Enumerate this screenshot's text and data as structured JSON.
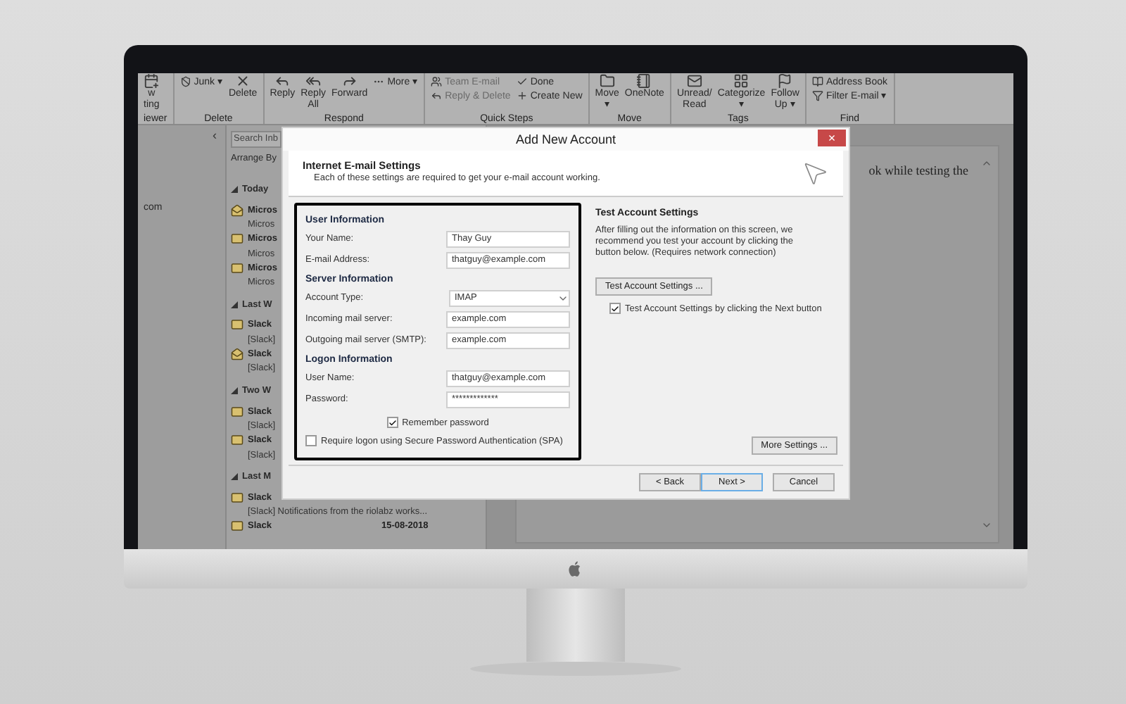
{
  "ribbon": {
    "groups": [
      {
        "label": "iewer",
        "items": [
          {
            "kind": "large",
            "lines": [
              "w",
              "ting"
            ]
          }
        ]
      },
      {
        "label": "Delete",
        "items": [
          {
            "kind": "stack",
            "buttons": [
              {
                "label": "Junk ▾",
                "disabled": false
              }
            ]
          },
          {
            "kind": "large",
            "lines": [
              "Delete"
            ]
          }
        ]
      },
      {
        "label": "Respond",
        "items": [
          {
            "kind": "large",
            "lines": [
              "Reply"
            ]
          },
          {
            "kind": "large",
            "lines": [
              "Reply",
              "All"
            ]
          },
          {
            "kind": "large",
            "lines": [
              "Forward"
            ]
          },
          {
            "kind": "stack",
            "buttons": [
              {
                "label": "More ▾",
                "disabled": false
              }
            ]
          }
        ]
      },
      {
        "label": "Quick Steps",
        "items": [
          {
            "kind": "stack",
            "buttons": [
              {
                "label": "Team E-mail",
                "disabled": true
              },
              {
                "label": "Reply & Delete",
                "disabled": true
              }
            ]
          },
          {
            "kind": "stack",
            "buttons": [
              {
                "label": "Done",
                "disabled": false
              },
              {
                "label": "Create New",
                "disabled": false
              }
            ]
          }
        ]
      },
      {
        "label": "Move",
        "items": [
          {
            "kind": "large",
            "lines": [
              "Move",
              "▾"
            ]
          },
          {
            "kind": "large",
            "lines": [
              "OneNote"
            ]
          }
        ]
      },
      {
        "label": "Tags",
        "items": [
          {
            "kind": "large",
            "lines": [
              "Unread/",
              "Read"
            ]
          },
          {
            "kind": "large",
            "lines": [
              "Categorize",
              "▾"
            ]
          },
          {
            "kind": "large",
            "lines": [
              "Follow",
              "Up ▾"
            ]
          }
        ]
      },
      {
        "label": "Find",
        "items": [
          {
            "kind": "stack",
            "buttons": [
              {
                "label": "Address Book",
                "disabled": false
              },
              {
                "label": "Filter E-mail ▾",
                "disabled": false
              }
            ]
          }
        ]
      }
    ]
  },
  "folders": {
    "collapse": "‹",
    "items": [
      {
        "label": "com",
        "selected": false
      }
    ]
  },
  "list": {
    "search": {
      "placeholder": "Search Inb"
    },
    "arrange": "Arrange By",
    "groups": [
      {
        "header": "Today",
        "messages": [
          {
            "sender": "Micros",
            "preview": "Micros",
            "read": true
          },
          {
            "sender": "Micros",
            "preview": "Micros",
            "read": false
          },
          {
            "sender": "Micros",
            "preview": "Micros",
            "read": false
          }
        ]
      },
      {
        "header": "Last W",
        "messages": [
          {
            "sender": "Slack",
            "preview": "[Slack]",
            "read": false
          },
          {
            "sender": "Slack",
            "preview": "[Slack]",
            "read": true
          }
        ]
      },
      {
        "header": "Two W",
        "messages": [
          {
            "sender": "Slack",
            "preview": "[Slack]",
            "read": false
          },
          {
            "sender": "Slack",
            "preview": "[Slack]",
            "read": false
          }
        ]
      },
      {
        "header": "Last M",
        "messages": [
          {
            "sender": "Slack",
            "preview": "[Slack] Notifications from the riolabz works...",
            "read": false
          },
          {
            "sender": "Slack",
            "date": "15-08-2018",
            "read": false
          }
        ]
      }
    ]
  },
  "reading": {
    "text": "ok while testing the"
  },
  "dialog": {
    "title": "Add New Account",
    "close": "×",
    "header": {
      "title": "Internet E-mail Settings",
      "subtitle": "Each of these settings are required to get your e-mail account working."
    },
    "sections": [
      {
        "title": "User Information",
        "fields": [
          {
            "label": "Your Name:",
            "value": "Thay Guy",
            "kind": "text"
          },
          {
            "label": "E-mail Address:",
            "value": "thatguy@example.com",
            "kind": "text"
          }
        ]
      },
      {
        "title": "Server Information",
        "fields": [
          {
            "label": "Account Type:",
            "value": "IMAP",
            "kind": "select"
          },
          {
            "label": "Incoming mail server:",
            "value": "example.com",
            "kind": "text"
          },
          {
            "label": "Outgoing mail server (SMTP):",
            "value": "example.com",
            "kind": "text"
          }
        ]
      },
      {
        "title": "Logon Information",
        "fields": [
          {
            "label": "User Name:",
            "value": "thatguy@example.com",
            "kind": "text"
          },
          {
            "label": "Password:",
            "value": "*************",
            "kind": "text"
          }
        ]
      }
    ],
    "remember_password": {
      "label": "Remember password",
      "checked": true
    },
    "spa": {
      "label": "Require logon using Secure Password Authentication (SPA)",
      "checked": false
    },
    "test": {
      "title": "Test Account Settings",
      "description": "After filling out the information on this screen, we recommend you test your account by clicking the button below. (Requires network connection)",
      "button": "Test Account Settings ...",
      "auto_test": {
        "label": "Test Account Settings by clicking the Next button",
        "checked": true
      }
    },
    "more_settings": "More Settings ...",
    "buttons": [
      {
        "label": "< Back",
        "selected": false
      },
      {
        "label": "Next >",
        "selected": true
      },
      {
        "label": "Cancel",
        "selected": false
      }
    ]
  }
}
